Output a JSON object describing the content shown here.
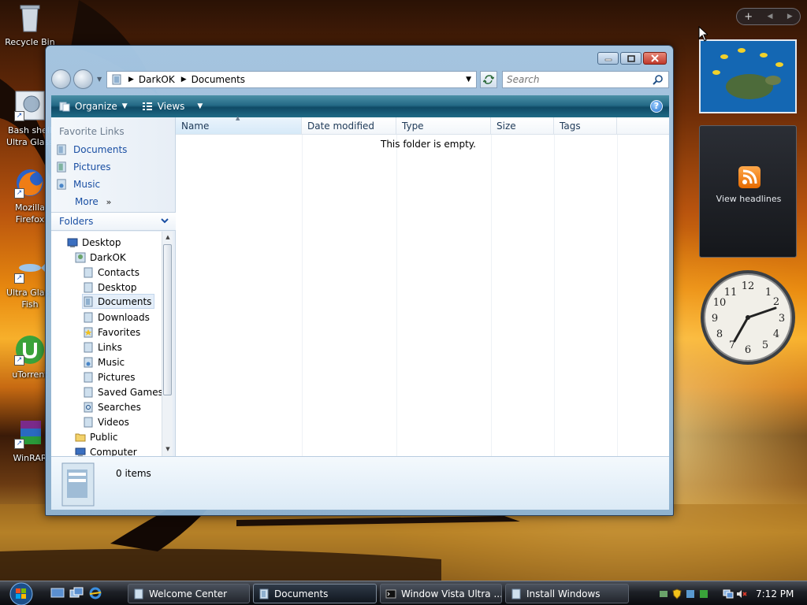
{
  "desktop": {
    "icons": [
      {
        "label": "Recycle Bin",
        "name": "recycle-bin-icon"
      },
      {
        "label": "Bash shell Ultra Glass",
        "name": "bash-shell-icon"
      },
      {
        "label": "Mozilla Firefox",
        "name": "firefox-icon"
      },
      {
        "label": "Ultra Glass Fish",
        "name": "fish-icon"
      },
      {
        "label": "uTorrent",
        "name": "utorrent-icon"
      },
      {
        "label": "WinRAR",
        "name": "winrar-icon"
      }
    ]
  },
  "window": {
    "address": {
      "crumbs": [
        "DarkOK",
        "Documents"
      ]
    },
    "search": {
      "placeholder": "Search"
    },
    "toolbar": {
      "organize_label": "Organize",
      "views_label": "Views",
      "help_label": "?"
    },
    "favorite_links": {
      "title": "Favorite Links",
      "items": [
        "Documents",
        "Pictures",
        "Music"
      ],
      "more_label": "More"
    },
    "folders": {
      "header": "Folders",
      "tree": [
        "Desktop",
        "DarkOK",
        "Contacts",
        "Desktop",
        "Documents",
        "Downloads",
        "Favorites",
        "Links",
        "Music",
        "Pictures",
        "Saved Games",
        "Searches",
        "Videos",
        "Public",
        "Computer"
      ]
    },
    "columns": [
      "Name",
      "Date modified",
      "Type",
      "Size",
      "Tags"
    ],
    "empty_message": "This folder is empty.",
    "details": {
      "items_count": "0 items"
    }
  },
  "sidebar": {
    "feed_label": "View headlines"
  },
  "taskbar": {
    "buttons": [
      "Welcome Center",
      "Documents",
      "Window Vista Ultra ...",
      "Install Windows"
    ],
    "time": "7:12 PM"
  }
}
